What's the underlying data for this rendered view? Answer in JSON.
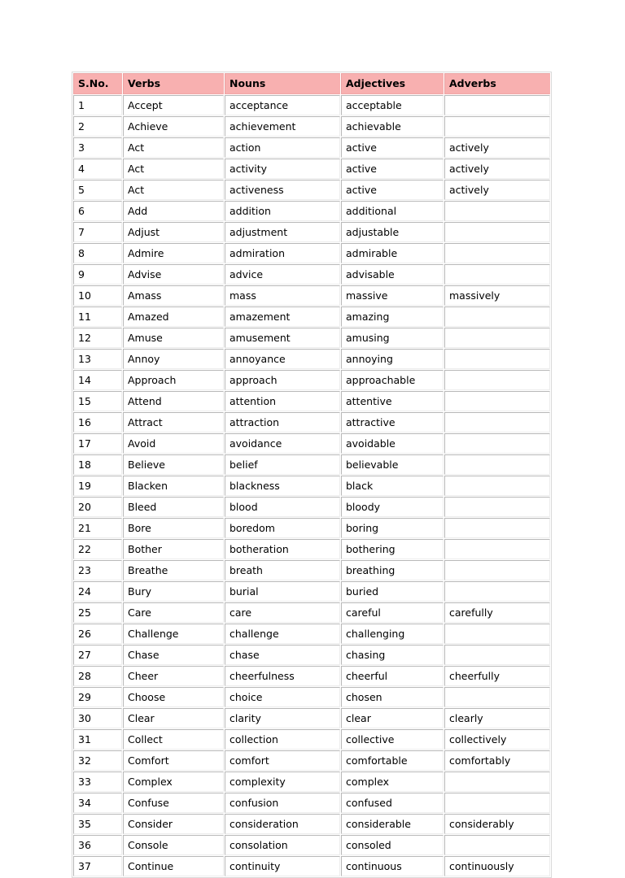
{
  "document": {
    "table_title": "",
    "header_fill": "#f8b0b0",
    "page_background": "#ffffff"
  },
  "table": {
    "columns": [
      {
        "key": "sno",
        "label": "S.No."
      },
      {
        "key": "verb",
        "label": "Verbs"
      },
      {
        "key": "noun",
        "label": "Nouns"
      },
      {
        "key": "adjective",
        "label": "Adjectives"
      },
      {
        "key": "adverb",
        "label": "Adverbs"
      }
    ],
    "rows": [
      {
        "sno": "1",
        "verb": "Accept",
        "noun": "acceptance",
        "adjective": "acceptable",
        "adverb": ""
      },
      {
        "sno": "2",
        "verb": "Achieve",
        "noun": "achievement",
        "adjective": "achievable",
        "adverb": ""
      },
      {
        "sno": "3",
        "verb": "Act",
        "noun": "action",
        "adjective": "active",
        "adverb": "actively"
      },
      {
        "sno": "4",
        "verb": "Act",
        "noun": "activity",
        "adjective": "active",
        "adverb": "actively"
      },
      {
        "sno": "5",
        "verb": "Act",
        "noun": "activeness",
        "adjective": "active",
        "adverb": "actively"
      },
      {
        "sno": "6",
        "verb": "Add",
        "noun": "addition",
        "adjective": "additional",
        "adverb": ""
      },
      {
        "sno": "7",
        "verb": "Adjust",
        "noun": "adjustment",
        "adjective": "adjustable",
        "adverb": ""
      },
      {
        "sno": "8",
        "verb": "Admire",
        "noun": "admiration",
        "adjective": "admirable",
        "adverb": ""
      },
      {
        "sno": "9",
        "verb": "Advise",
        "noun": "advice",
        "adjective": "advisable",
        "adverb": ""
      },
      {
        "sno": "10",
        "verb": "Amass",
        "noun": "mass",
        "adjective": "massive",
        "adverb": "massively"
      },
      {
        "sno": "11",
        "verb": "Amazed",
        "noun": "amazement",
        "adjective": "amazing",
        "adverb": ""
      },
      {
        "sno": "12",
        "verb": "Amuse",
        "noun": "amusement",
        "adjective": "amusing",
        "adverb": ""
      },
      {
        "sno": "13",
        "verb": "Annoy",
        "noun": "annoyance",
        "adjective": "annoying",
        "adverb": ""
      },
      {
        "sno": "14",
        "verb": "Approach",
        "noun": "approach",
        "adjective": "approachable",
        "adverb": ""
      },
      {
        "sno": "15",
        "verb": "Attend",
        "noun": "attention",
        "adjective": "attentive",
        "adverb": ""
      },
      {
        "sno": "16",
        "verb": "Attract",
        "noun": "attraction",
        "adjective": "attractive",
        "adverb": ""
      },
      {
        "sno": "17",
        "verb": "Avoid",
        "noun": "avoidance",
        "adjective": "avoidable",
        "adverb": ""
      },
      {
        "sno": "18",
        "verb": "Believe",
        "noun": "belief",
        "adjective": "believable",
        "adverb": ""
      },
      {
        "sno": "19",
        "verb": "Blacken",
        "noun": "blackness",
        "adjective": "black",
        "adverb": ""
      },
      {
        "sno": "20",
        "verb": "Bleed",
        "noun": "blood",
        "adjective": "bloody",
        "adverb": ""
      },
      {
        "sno": "21",
        "verb": "Bore",
        "noun": "boredom",
        "adjective": "boring",
        "adverb": ""
      },
      {
        "sno": "22",
        "verb": "Bother",
        "noun": "botheration",
        "adjective": "bothering",
        "adverb": ""
      },
      {
        "sno": "23",
        "verb": "Breathe",
        "noun": "breath",
        "adjective": "breathing",
        "adverb": ""
      },
      {
        "sno": "24",
        "verb": "Bury",
        "noun": "burial",
        "adjective": "buried",
        "adverb": ""
      },
      {
        "sno": "25",
        "verb": "Care",
        "noun": "care",
        "adjective": "careful",
        "adverb": "carefully"
      },
      {
        "sno": "26",
        "verb": "Challenge",
        "noun": "challenge",
        "adjective": "challenging",
        "adverb": ""
      },
      {
        "sno": "27",
        "verb": "Chase",
        "noun": "chase",
        "adjective": "chasing",
        "adverb": ""
      },
      {
        "sno": "28",
        "verb": "Cheer",
        "noun": "cheerfulness",
        "adjective": "cheerful",
        "adverb": "cheerfully"
      },
      {
        "sno": "29",
        "verb": "Choose",
        "noun": "choice",
        "adjective": "chosen",
        "adverb": ""
      },
      {
        "sno": "30",
        "verb": "Clear",
        "noun": "clarity",
        "adjective": "clear",
        "adverb": "clearly"
      },
      {
        "sno": "31",
        "verb": "Collect",
        "noun": "collection",
        "adjective": "collective",
        "adverb": "collectively"
      },
      {
        "sno": "32",
        "verb": "Comfort",
        "noun": "comfort",
        "adjective": "comfortable",
        "adverb": "comfortably"
      },
      {
        "sno": "33",
        "verb": "Complex",
        "noun": "complexity",
        "adjective": "complex",
        "adverb": ""
      },
      {
        "sno": "34",
        "verb": "Confuse",
        "noun": "confusion",
        "adjective": "confused",
        "adverb": ""
      },
      {
        "sno": "35",
        "verb": "Consider",
        "noun": "consideration",
        "adjective": "considerable",
        "adverb": "considerably"
      },
      {
        "sno": "36",
        "verb": "Console",
        "noun": "consolation",
        "adjective": "consoled",
        "adverb": ""
      },
      {
        "sno": "37",
        "verb": "Continue",
        "noun": "continuity",
        "adjective": "continuous",
        "adverb": "continuously"
      }
    ]
  }
}
